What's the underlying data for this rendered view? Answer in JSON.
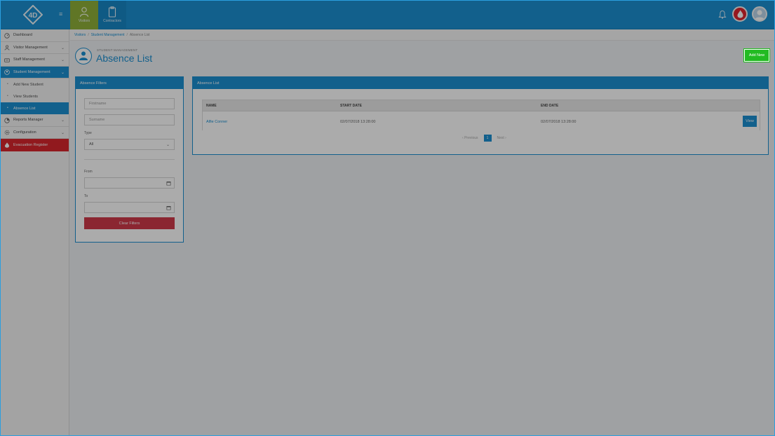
{
  "topnav": {
    "visitors_label": "Visitors",
    "contractors_label": "Contractors"
  },
  "sidebar": {
    "items": [
      {
        "label": "Dashboard"
      },
      {
        "label": "Visitor Management"
      },
      {
        "label": "Staff Management"
      },
      {
        "label": "Student Management"
      },
      {
        "label": "Add New Student"
      },
      {
        "label": "View Students"
      },
      {
        "label": "Absence List"
      },
      {
        "label": "Reports Manager"
      },
      {
        "label": "Configuration"
      },
      {
        "label": "Evacuation Register"
      }
    ]
  },
  "breadcrumb": {
    "items": [
      "Visitors",
      "Student Management",
      "Absence List"
    ],
    "separator": "/"
  },
  "header": {
    "subtitle": "STUDENT MANAGEMENT",
    "title": "Absence List",
    "add_new_label": "Add New"
  },
  "filters": {
    "title": "Absence Filters",
    "firstname_placeholder": "Firstname",
    "surname_placeholder": "Surname",
    "type_label": "Type",
    "type_value": "All",
    "from_label": "From",
    "to_label": "To",
    "clear_label": "Clear Filters"
  },
  "list": {
    "title": "Absence List",
    "columns": [
      "NAME",
      "START DATE",
      "END DATE"
    ],
    "rows": [
      {
        "name": "Alfie Conner",
        "start": "02/07/2018 13:28:00",
        "end": "02/07/2018 13:28:00",
        "action": "View"
      }
    ],
    "pager": {
      "previous": "Previous",
      "current": "1",
      "next": "Next"
    }
  },
  "colors": {
    "primary": "#1b8fd1",
    "visitors_tab": "#8fb03a",
    "evacuation": "#d9262e",
    "add_new": "#22bb22",
    "clear_filters": "#cf3a4a"
  }
}
